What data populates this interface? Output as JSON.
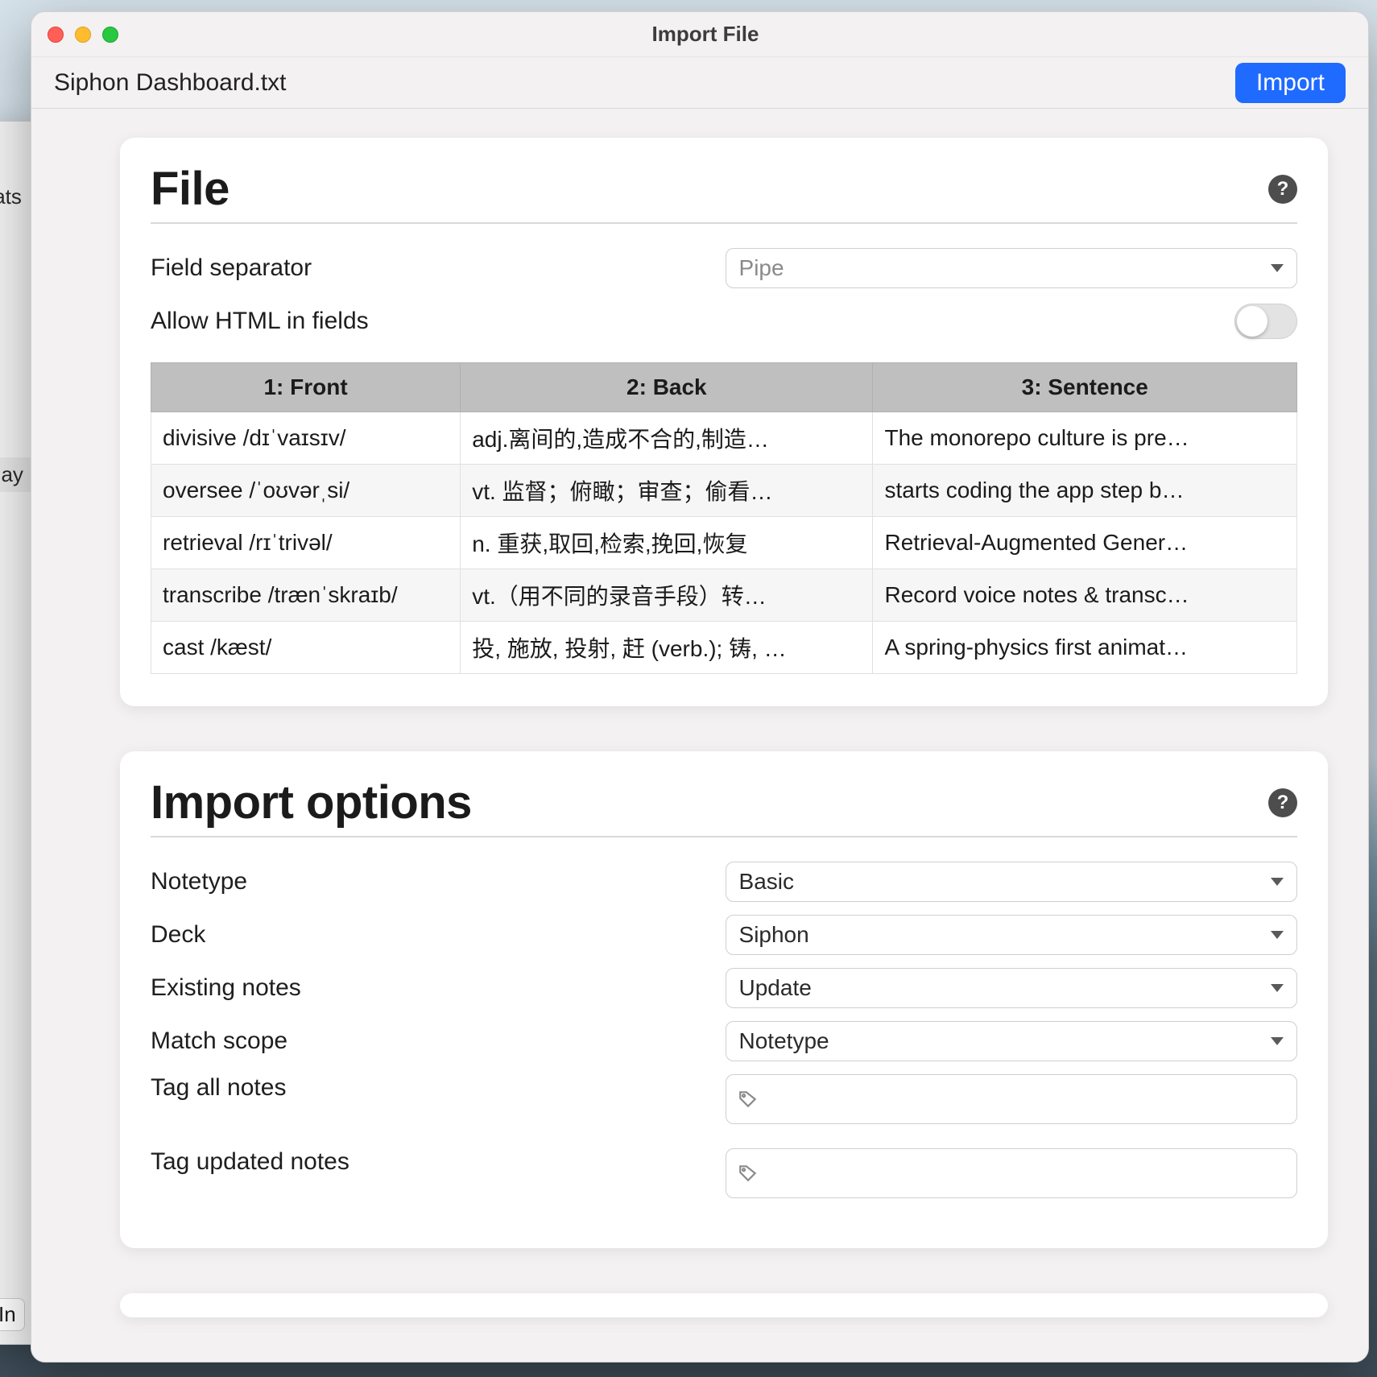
{
  "bg": {
    "row1": "tats",
    "row2": "day",
    "btn": "In"
  },
  "window": {
    "title": "Import File",
    "filename": "Siphon Dashboard.txt",
    "import_label": "Import"
  },
  "file": {
    "heading": "File",
    "field_separator_label": "Field separator",
    "field_separator_value": "Pipe",
    "allow_html_label": "Allow HTML in fields",
    "allow_html_value": false,
    "columns": [
      "1: Front",
      "2: Back",
      "3: Sentence"
    ],
    "rows": [
      {
        "front": "divisive /dɪˈvaɪsɪv/",
        "back": "adj.离间的,造成不合的,制造…",
        "sentence": "The monorepo culture is pre…"
      },
      {
        "front": "oversee /ˈoʊvərˌsi/",
        "back": "vt. 监督；俯瞰；审查；偷看…",
        "sentence": "starts coding the app step b…"
      },
      {
        "front": "retrieval /rɪˈtrivəl/",
        "back": "n. 重获,取回,检索,挽回,恢复",
        "sentence": "Retrieval-Augmented Gener…"
      },
      {
        "front": "transcribe /trænˈskraɪb/",
        "back": "vt.（用不同的录音手段）转…",
        "sentence": "Record voice notes & transc…"
      },
      {
        "front": "cast /kæst/",
        "back": "投, 施放, 投射, 赶 (verb.); 铸, …",
        "sentence": "A spring-physics first animat…"
      }
    ]
  },
  "options": {
    "heading": "Import options",
    "notetype_label": "Notetype",
    "notetype_value": "Basic",
    "deck_label": "Deck",
    "deck_value": "Siphon",
    "existing_label": "Existing notes",
    "existing_value": "Update",
    "scope_label": "Match scope",
    "scope_value": "Notetype",
    "tag_all_label": "Tag all notes",
    "tag_updated_label": "Tag updated notes"
  }
}
